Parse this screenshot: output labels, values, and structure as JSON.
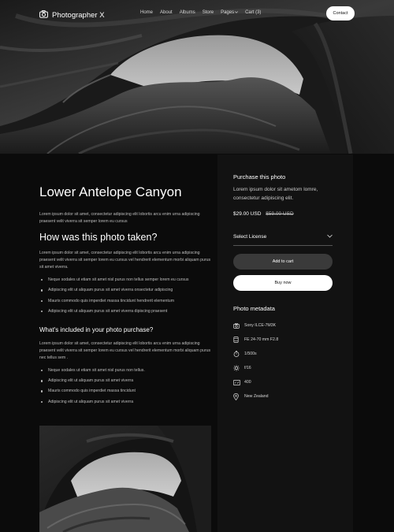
{
  "nav": {
    "brand": "Photographer X",
    "links": [
      "Home",
      "About",
      "Albums",
      "Store",
      "Pages",
      "Cart (3)"
    ],
    "contact_label": "Contact"
  },
  "article": {
    "title": "Lower Antelope Canyon",
    "intro": "Lorem ipsum dolor sit amet, consectetur adipiscing elit lobortis arcu enim urna adipiscing praesent velit viverra sit semper lorem eu cursus",
    "section1_heading": "How was this photo taken?",
    "section1_text": "Lorem ipsum dolor sit amet, consectetur adipiscing elit lobortis arcu enim urna adipiscing praesent velit viverra sit semper lorem eu cursus vel hendrerit elementum morbi aliquam purus sit amet viverra.",
    "section1_bullets": [
      "Neque sodales ut etiam sit amet nisl purus non tellus semper lorem eu cursus",
      "Adipiscing elit ut aliquam purus sit amet viverra onsectetur adipiscing",
      "Mauris commodo quis imperdiet massa tincidunt hendrerit elementum",
      "Adipiscing elit ut aliquam purus sit amet viverra dipiscing praesent"
    ],
    "section2_heading": "What's included in your photo purchase?",
    "section2_text": "Lorem ipsum dolor sit amet, consectetur adipiscing elit lobortis arcu enim urna adipiscing praesent velit viverra sit semper lorem eu cursus vel hendrerit elementum morbi aliquam purus nec tellus sem .",
    "section2_bullets": [
      "Neque sodales ut etiam sit amet nisl purus non tellus.",
      "Adipiscing elit ut aliquam purus sit amet viverra",
      "Mauris commodo quis imperdiet massa tincidunt",
      "Adipiscing elit ut aliquam purus sit amet viverra"
    ]
  },
  "purchase": {
    "title": "Purchase this photo",
    "description": "Lorem ipsum dolor sit ametom lomre, consectetur adipiscing elit.",
    "price": "$29.00 USD",
    "old_price": "$59.00 USD",
    "license_label": "Select License",
    "add_to_cart_label": "Add to cart",
    "buy_now_label": "Buy now"
  },
  "metadata": {
    "title": "Photo metadata",
    "items": [
      {
        "icon": "camera-icon",
        "value": "Sony ILCE-7M3K"
      },
      {
        "icon": "lens-icon",
        "value": "FE 24-70 mm F2.8"
      },
      {
        "icon": "timer-icon",
        "value": "1/500s"
      },
      {
        "icon": "aperture-icon",
        "value": "f/16"
      },
      {
        "icon": "iso-icon",
        "value": "400"
      },
      {
        "icon": "location-pin-icon",
        "value": "New Zealand"
      }
    ]
  },
  "colors": {
    "background": "#0b0b0b",
    "panel": "#121212",
    "button_dark": "#3a3a3a",
    "button_light": "#ffffff"
  }
}
